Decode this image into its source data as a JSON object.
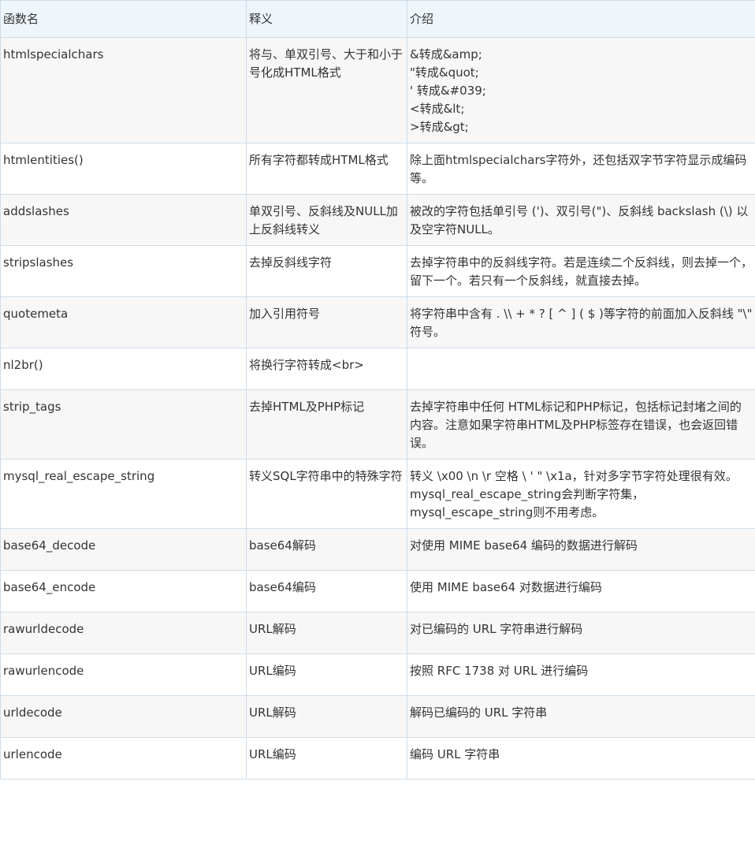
{
  "table": {
    "headers": [
      "函数名",
      "释义",
      "介绍"
    ],
    "rows": [
      {
        "name": "htmlspecialchars",
        "meaning": "将与、单双引号、大于和小于号化成HTML格式",
        "intro_lines": [
          "&转成&amp;",
          "\"转成&quot;",
          "' 转成&#039;",
          "<转成&lt;",
          ">转成&gt;"
        ]
      },
      {
        "name": "htmlentities()",
        "meaning": "所有字符都转成HTML格式",
        "intro_lines": [
          "除上面htmlspecialchars字符外，还包括双字节字符显示成编码等。"
        ]
      },
      {
        "name": "addslashes",
        "meaning": "单双引号、反斜线及NULL加上反斜线转义",
        "intro_lines": [
          "被改的字符包括单引号 (')、双引号(\")、反斜线 backslash (\\) 以及空字符NULL。"
        ]
      },
      {
        "name": "stripslashes",
        "meaning": "去掉反斜线字符",
        "intro_lines": [
          "去掉字符串中的反斜线字符。若是连续二个反斜线，则去掉一个，留下一个。若只有一个反斜线，就直接去掉。"
        ]
      },
      {
        "name": "quotemeta",
        "meaning": "加入引用符号",
        "intro_lines": [
          "将字符串中含有 . \\\\ + * ? [ ^ ] ( $ )等字符的前面加入反斜线 \"\\\" 符号。"
        ]
      },
      {
        "name": "nl2br()",
        "meaning": "将换行字符转成<br>",
        "intro_lines": [
          ""
        ]
      },
      {
        "name": "strip_tags",
        "meaning": "去掉HTML及PHP标记",
        "intro_lines": [
          "去掉字符串中任何 HTML标记和PHP标记，包括标记封堵之间的内容。注意如果字符串HTML及PHP标签存在错误，也会返回错误。"
        ]
      },
      {
        "name": "mysql_real_escape_string",
        "meaning": "转义SQL字符串中的特殊字符",
        "intro_lines": [
          "转义 \\x00  \\n  \\r  空格  \\  '  \" \\x1a，针对多字节字符处理很有效。mysql_real_escape_string会判断字符集，mysql_escape_string则不用考虑。"
        ]
      },
      {
        "name": "base64_decode",
        "meaning": "base64解码",
        "intro_lines": [
          "对使用 MIME base64 编码的数据进行解码"
        ]
      },
      {
        "name": "base64_encode",
        "meaning": "base64编码",
        "intro_lines": [
          "使用 MIME base64 对数据进行编码"
        ]
      },
      {
        "name": "rawurldecode",
        "meaning": "URL解码",
        "intro_lines": [
          "对已编码的 URL 字符串进行解码"
        ]
      },
      {
        "name": "rawurlencode",
        "meaning": "URL编码",
        "intro_lines": [
          "按照 RFC 1738 对 URL 进行编码"
        ]
      },
      {
        "name": "urldecode",
        "meaning": "URL解码",
        "intro_lines": [
          "解码已编码的 URL 字符串"
        ]
      },
      {
        "name": "urlencode",
        "meaning": "URL编码",
        "intro_lines": [
          "编码 URL 字符串"
        ]
      }
    ]
  }
}
